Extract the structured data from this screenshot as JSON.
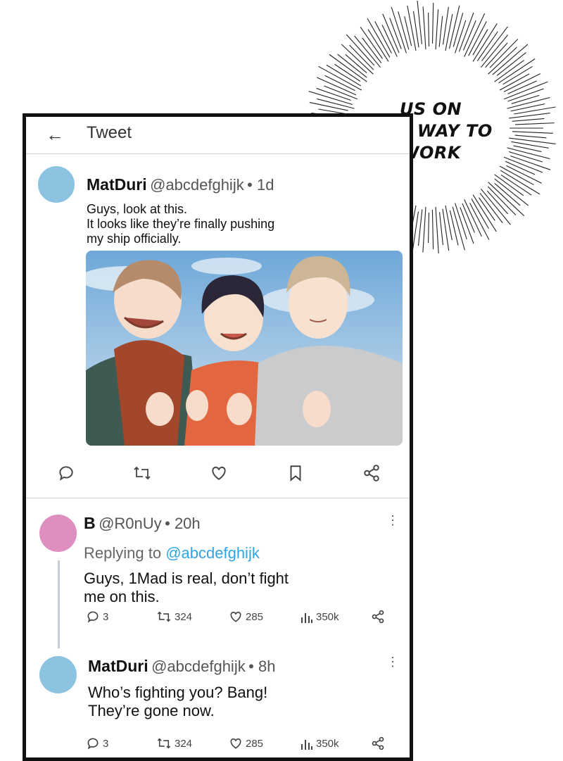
{
  "header": {
    "back_icon": "arrow-left-icon",
    "title": "Tweet"
  },
  "post": {
    "name": "MatDuri",
    "handle": "@abcdefghijk",
    "time": "• 1d",
    "lines": [
      "Guys, look at this.",
      "It looks like they’re finally pushing",
      "my ship officially."
    ],
    "image": "illustration of three young men making finger-heart gestures",
    "actions": [
      "reply-icon",
      "retweet-icon",
      "like-icon",
      "bookmark-icon",
      "share-icon"
    ]
  },
  "replies": [
    {
      "name": "B",
      "handle": "@R0nUy",
      "time": "• 20h",
      "replying_label": "Replying to",
      "replying_to": "@abcdefghijk",
      "lines": [
        "Guys, 1Mad is real, don’t fight",
        "me on this."
      ],
      "stats": {
        "replies": "3",
        "retweets": "324",
        "likes": "285",
        "views": "350k"
      }
    },
    {
      "name": "MatDuri",
      "handle": "@abcdefghijk",
      "time": "• 8h",
      "lines": [
        "Who’s fighting you? Bang!",
        "They’re gone now."
      ],
      "stats": {
        "replies": "3",
        "retweets": "324",
        "likes": "285",
        "views": "350k"
      }
    }
  ],
  "caption": {
    "lines": [
      "US ON",
      "OUR WAY TO",
      "WORK"
    ]
  },
  "colors": {
    "link": "#2fa5e4",
    "avatar_blue": "#8cc3e0",
    "avatar_pink": "#df8fbf"
  }
}
